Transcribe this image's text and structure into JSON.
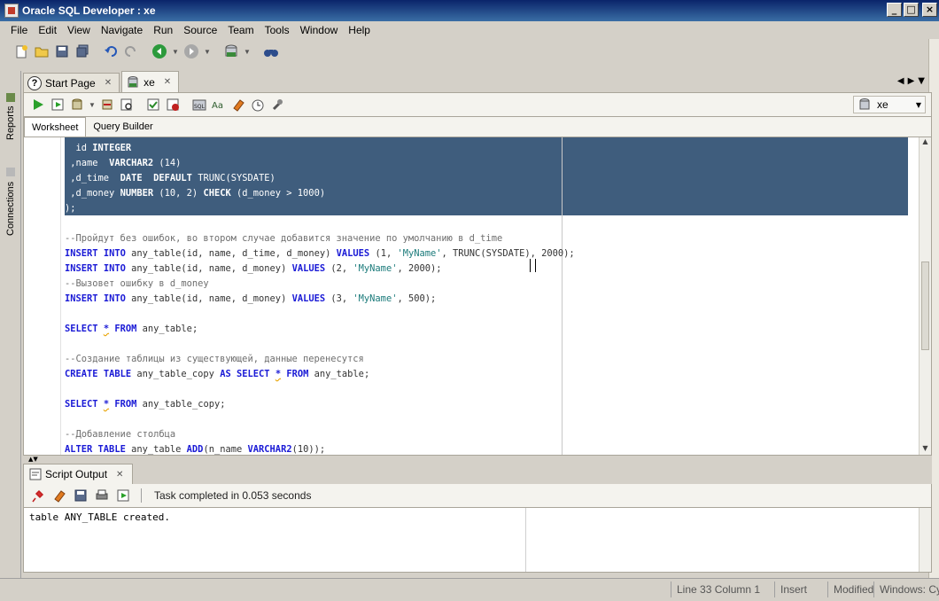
{
  "window": {
    "title": "Oracle SQL Developer : xe",
    "minimize": "_",
    "maximize": "□",
    "close": "×"
  },
  "menu": [
    "File",
    "Edit",
    "View",
    "Navigate",
    "Run",
    "Source",
    "Team",
    "Tools",
    "Window",
    "Help"
  ],
  "side_tabs": {
    "reports": "Reports",
    "connections": "Connections"
  },
  "doc_tabs": [
    {
      "label": "Start Page",
      "icon": "help-circle-icon"
    },
    {
      "label": "xe",
      "icon": "sql-worksheet-icon"
    }
  ],
  "connection_select": {
    "value": "xe"
  },
  "sub_tabs": {
    "worksheet": "Worksheet",
    "query_builder": "Query Builder"
  },
  "editor": {
    "lines": [
      "  id INTEGER",
      " ,name  VARCHAR2 (14)",
      " ,d_time  DATE  DEFAULT TRUNC(SYSDATE)",
      " ,d_money NUMBER (10, 2) CHECK (d_money > 1000)",
      ");",
      "",
      "--Пройдут без ошибок, во втором случае добавится значение по умолчанию в d_time",
      "INSERT INTO any_table(id, name, d_time, d_money) VALUES (1, 'MyName', TRUNC(SYSDATE), 2000);",
      "INSERT INTO any_table(id, name, d_money) VALUES (2, 'MyName', 2000);",
      "--Вызовет ошибку в d_money",
      "INSERT INTO any_table(id, name, d_money) VALUES (3, 'MyName', 500);",
      "",
      "SELECT * FROM any_table;",
      "",
      "--Создание таблицы из существующей, данные перенесутся",
      "CREATE TABLE any_table_copy AS SELECT * FROM any_table;",
      "",
      "SELECT * FROM any_table_copy;",
      "",
      "--Добавление столбца",
      "ALTER TABLE any_table ADD(n_name VARCHAR2(10));"
    ]
  },
  "output": {
    "tab_label": "Script Output",
    "task_status": "Task completed in 0.053 seconds",
    "text": "table ANY_TABLE created."
  },
  "status": {
    "position": "Line 33 Column 1",
    "mode": "Insert",
    "modified": "Modified",
    "encoding": "Windows: Cy"
  }
}
